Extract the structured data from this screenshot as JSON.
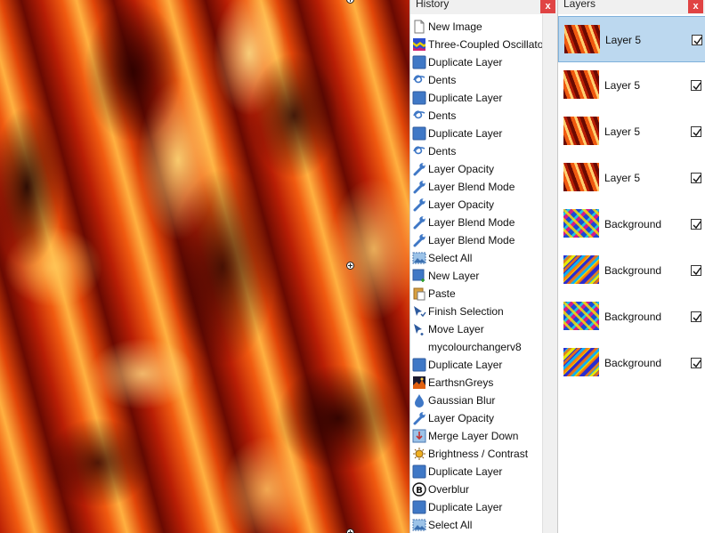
{
  "history": {
    "title": "History",
    "close_label": "x",
    "items": [
      {
        "label": "New Image",
        "icon": "new-image-icon"
      },
      {
        "label": "Three-Coupled Oscillators",
        "icon": "effect-thumbnail-icon"
      },
      {
        "label": "Duplicate Layer",
        "icon": "layer-icon"
      },
      {
        "label": "Dents",
        "icon": "dents-icon"
      },
      {
        "label": "Duplicate Layer",
        "icon": "layer-icon"
      },
      {
        "label": "Dents",
        "icon": "dents-icon"
      },
      {
        "label": "Duplicate Layer",
        "icon": "layer-icon"
      },
      {
        "label": "Dents",
        "icon": "dents-icon"
      },
      {
        "label": "Layer Opacity",
        "icon": "wrench-icon"
      },
      {
        "label": "Layer Blend Mode",
        "icon": "wrench-icon"
      },
      {
        "label": "Layer Opacity",
        "icon": "wrench-icon"
      },
      {
        "label": "Layer Blend Mode",
        "icon": "wrench-icon"
      },
      {
        "label": "Layer Blend Mode",
        "icon": "wrench-icon"
      },
      {
        "label": "Select All",
        "icon": "select-all-icon"
      },
      {
        "label": "New Layer",
        "icon": "new-layer-icon"
      },
      {
        "label": "Paste",
        "icon": "paste-icon"
      },
      {
        "label": "Finish Selection",
        "icon": "finish-selection-icon"
      },
      {
        "label": "Move Layer",
        "icon": "move-layer-icon"
      },
      {
        "label": "mycolourchangerv8",
        "icon": ""
      },
      {
        "label": "Duplicate Layer",
        "icon": "layer-icon"
      },
      {
        "label": "EarthsnGreys",
        "icon": "earth-thumbnail-icon"
      },
      {
        "label": "Gaussian Blur",
        "icon": "droplet-icon"
      },
      {
        "label": "Layer Opacity",
        "icon": "wrench-icon"
      },
      {
        "label": "Merge Layer Down",
        "icon": "merge-down-icon"
      },
      {
        "label": "Brightness / Contrast",
        "icon": "brightness-icon"
      },
      {
        "label": "Duplicate Layer",
        "icon": "layer-icon"
      },
      {
        "label": "Overblur",
        "icon": "b-letter-icon"
      },
      {
        "label": "Duplicate Layer",
        "icon": "layer-icon"
      },
      {
        "label": "Select All",
        "icon": "select-all-icon"
      }
    ]
  },
  "layers": {
    "title": "Layers",
    "close_label": "x",
    "items": [
      {
        "name": "Layer 5",
        "visible": true,
        "selected": true,
        "thumb": "fire"
      },
      {
        "name": "Layer 5",
        "visible": true,
        "selected": false,
        "thumb": "fire"
      },
      {
        "name": "Layer 5",
        "visible": true,
        "selected": false,
        "thumb": "fire"
      },
      {
        "name": "Layer 5",
        "visible": true,
        "selected": false,
        "thumb": "fire"
      },
      {
        "name": "Background",
        "visible": true,
        "selected": false,
        "thumb": "zig"
      },
      {
        "name": "Background",
        "visible": true,
        "selected": false,
        "thumb": "zig2"
      },
      {
        "name": "Background",
        "visible": true,
        "selected": false,
        "thumb": "zig"
      },
      {
        "name": "Background",
        "visible": true,
        "selected": false,
        "thumb": "zig2"
      }
    ]
  },
  "colors": {
    "close_button": "#e04343",
    "selected_row": "#bcd8ef",
    "icon_blue": "#3f78c6"
  }
}
